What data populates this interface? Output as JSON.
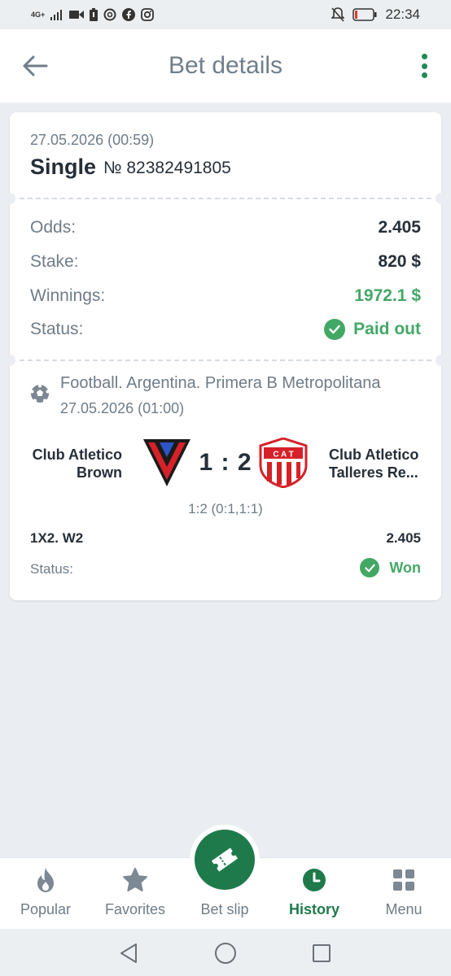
{
  "status_bar": {
    "network": "4G+",
    "time": "22:34"
  },
  "header": {
    "title": "Bet details",
    "back_icon": "arrow-left-icon",
    "more_icon": "more-vertical-icon"
  },
  "bet": {
    "datetime": "27.05.2026 (00:59)",
    "type": "Single",
    "number": "№ 82382491805",
    "summary": [
      {
        "label": "Odds:",
        "value": "2.405"
      },
      {
        "label": "Stake:",
        "value": "820 $"
      },
      {
        "label": "Winnings:",
        "value": "1972.1 $"
      },
      {
        "label": "Status:",
        "value": "Paid out"
      }
    ]
  },
  "event": {
    "league": "Football. Argentina. Primera B Metropolitana",
    "datetime": "27.05.2026 (01:00)",
    "team1": "Club Atletico Brown",
    "team2": "Club Atletico Talleres Re...",
    "score": "1 : 2",
    "score_detail": "1:2 (0:1,1:1)",
    "market": "1X2. W2",
    "market_odds": "2.405",
    "status_label": "Status:",
    "status_value": "Won",
    "team2_badge": "C A T"
  },
  "nav": {
    "items": [
      {
        "label": "Popular",
        "icon": "fire-icon"
      },
      {
        "label": "Favorites",
        "icon": "star-icon"
      },
      {
        "label": "Bet slip",
        "icon": "ticket-icon"
      },
      {
        "label": "History",
        "icon": "clock-icon"
      },
      {
        "label": "Menu",
        "icon": "grid-icon"
      }
    ],
    "active": "History"
  },
  "colors": {
    "accent": "#1f7a4b",
    "success": "#43a866",
    "muted": "#6f7c87",
    "text": "#262f38",
    "background": "#eaeef2"
  }
}
